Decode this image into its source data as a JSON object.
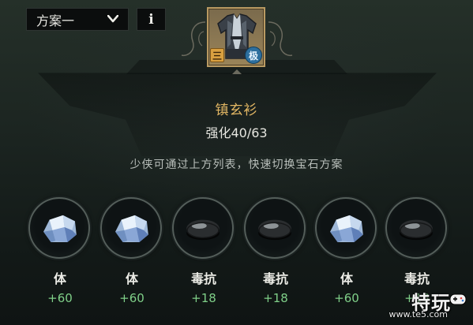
{
  "plan_select": {
    "label": "方案一"
  },
  "info_button": {
    "label": "i"
  },
  "item": {
    "tier_badge": "三",
    "grade_badge": "极",
    "name": "镇玄衫",
    "refine_label": "强化",
    "refine_value": "40/63"
  },
  "hint": "少侠可通过上方列表，快速切换宝石方案",
  "gems": [
    {
      "icon": "crystal-gem-icon",
      "name": "体",
      "value": "+60"
    },
    {
      "icon": "crystal-gem-icon",
      "name": "体",
      "value": "+60"
    },
    {
      "icon": "black-stone-gem-icon",
      "name": "毒抗",
      "value": "+18"
    },
    {
      "icon": "black-stone-gem-icon",
      "name": "毒抗",
      "value": "+18"
    },
    {
      "icon": "crystal-gem-icon",
      "name": "体",
      "value": "+60"
    },
    {
      "icon": "black-stone-gem-icon",
      "name": "毒抗",
      "value": "+18"
    }
  ],
  "watermark": {
    "brand": "特玩",
    "url": "www.te5.com"
  },
  "colors": {
    "item_name": "#e3b764",
    "stat_value": "#7fcf88",
    "frame_gold": "#b99a62"
  }
}
